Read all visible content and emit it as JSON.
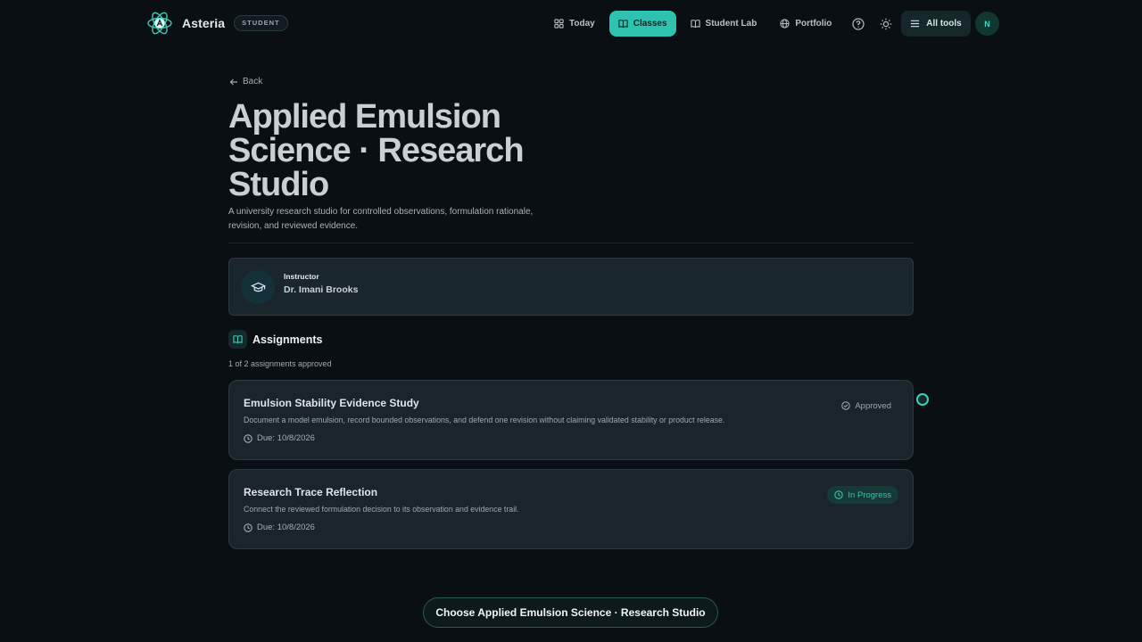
{
  "brand": {
    "name": "Asteria",
    "role_badge": "STUDENT"
  },
  "nav": {
    "items": [
      {
        "label": "Today",
        "icon": "grid-icon",
        "active": false
      },
      {
        "label": "Classes",
        "icon": "book-icon",
        "active": true
      },
      {
        "label": "Student Lab",
        "icon": "book-open-icon",
        "active": false
      },
      {
        "label": "Portfolio",
        "icon": "globe-icon",
        "active": false
      }
    ],
    "all_tools_label": "All tools",
    "avatar_initial": "N"
  },
  "page": {
    "back_label": "Back",
    "title": "Applied Emulsion Science · Research Studio",
    "description": "A university research studio for controlled observations, formulation rationale, revision, and reviewed evidence."
  },
  "instructor": {
    "label": "Instructor",
    "name": "Dr. Imani Brooks"
  },
  "assignments": {
    "heading": "Assignments",
    "progress_text": "1 of 2 assignments approved",
    "items": [
      {
        "title": "Emulsion Stability Evidence Study",
        "description": "Document a model emulsion, record bounded observations, and defend one revision without claiming validated stability or product release.",
        "due": "Due: 10/8/2026",
        "status": "Approved"
      },
      {
        "title": "Research Trace Reflection",
        "description": "Connect the reviewed formulation decision to its observation and evidence trail.",
        "due": "Due: 10/8/2026",
        "status": "In Progress"
      }
    ]
  },
  "cta": {
    "label": "Choose Applied Emulsion Science · Research Studio"
  },
  "colors": {
    "accent": "#2dc3b0",
    "background": "#0a0f14",
    "card": "#19252b"
  }
}
